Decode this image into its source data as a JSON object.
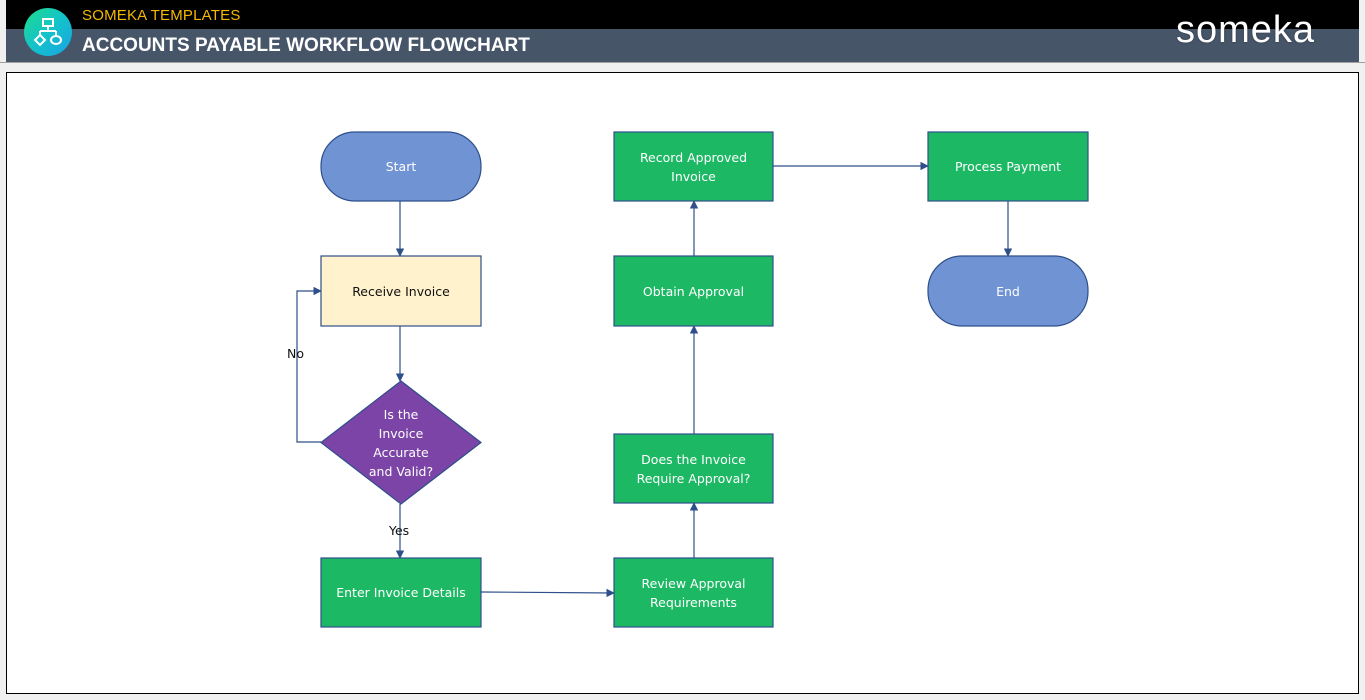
{
  "header": {
    "brand": "SOMEKA TEMPLATES",
    "title": "ACCOUNTS PAYABLE WORKFLOW FLOWCHART",
    "logo_text": "someka",
    "app_icon": "flowchart-icon"
  },
  "colors": {
    "terminal_fill": "#6f93d3",
    "process_fill": "#1db864",
    "input_fill": "#fff2cc",
    "decision_fill": "#7b44a6",
    "stroke": "#2f4f8a",
    "header_black": "#000000",
    "header_slate": "#475569",
    "brand_yellow": "#f5b800"
  },
  "flowchart": {
    "nodes": [
      {
        "id": "start",
        "type": "terminal",
        "label": "Start"
      },
      {
        "id": "receive",
        "type": "input",
        "label": "Receive Invoice"
      },
      {
        "id": "valid",
        "type": "decision",
        "label": "Is the Invoice Accurate and Valid?"
      },
      {
        "id": "enter",
        "type": "process",
        "label": "Enter Invoice Details"
      },
      {
        "id": "review",
        "type": "process",
        "label": "Review Approval Requirements"
      },
      {
        "id": "require",
        "type": "process",
        "label": "Does the Invoice Require Approval?"
      },
      {
        "id": "obtain",
        "type": "process",
        "label": "Obtain Approval"
      },
      {
        "id": "record",
        "type": "process",
        "label": "Record Approved Invoice"
      },
      {
        "id": "payment",
        "type": "process",
        "label": "Process Payment"
      },
      {
        "id": "end",
        "type": "terminal",
        "label": "End"
      }
    ],
    "edges": [
      {
        "from": "start",
        "to": "receive",
        "label": ""
      },
      {
        "from": "receive",
        "to": "valid",
        "label": ""
      },
      {
        "from": "valid",
        "to": "receive",
        "label": "No"
      },
      {
        "from": "valid",
        "to": "enter",
        "label": "Yes"
      },
      {
        "from": "enter",
        "to": "review",
        "label": ""
      },
      {
        "from": "review",
        "to": "require",
        "label": ""
      },
      {
        "from": "require",
        "to": "obtain",
        "label": ""
      },
      {
        "from": "obtain",
        "to": "record",
        "label": ""
      },
      {
        "from": "record",
        "to": "payment",
        "label": ""
      },
      {
        "from": "payment",
        "to": "end",
        "label": ""
      }
    ]
  }
}
